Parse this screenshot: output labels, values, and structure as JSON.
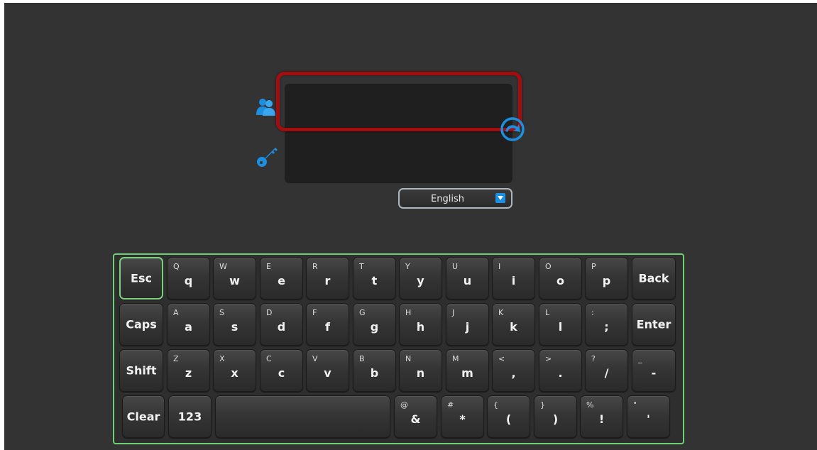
{
  "login": {
    "username_value": "",
    "password_value": ""
  },
  "language": {
    "selected": "English"
  },
  "icons": {
    "user": "users-icon",
    "password": "key-icon",
    "submit": "go-arrow-icon",
    "dropdown": "chevron-down-icon"
  },
  "colors": {
    "accent": "#1d8fe0",
    "highlight": "#a30d10",
    "keyboard_border": "#6fcf75",
    "background": "#333333"
  },
  "keyboard": {
    "esc": "Esc",
    "back": "Back",
    "caps": "Caps",
    "enter": "Enter",
    "shift": "Shift",
    "clear": "Clear",
    "num": "123",
    "space": "",
    "row1": [
      {
        "main": "q",
        "sub": "Q"
      },
      {
        "main": "w",
        "sub": "W"
      },
      {
        "main": "e",
        "sub": "E"
      },
      {
        "main": "r",
        "sub": "R"
      },
      {
        "main": "t",
        "sub": "T"
      },
      {
        "main": "y",
        "sub": "Y"
      },
      {
        "main": "u",
        "sub": "U"
      },
      {
        "main": "i",
        "sub": "I"
      },
      {
        "main": "o",
        "sub": "O"
      },
      {
        "main": "p",
        "sub": "P"
      }
    ],
    "row2": [
      {
        "main": "a",
        "sub": "A"
      },
      {
        "main": "s",
        "sub": "S"
      },
      {
        "main": "d",
        "sub": "D"
      },
      {
        "main": "f",
        "sub": "F"
      },
      {
        "main": "g",
        "sub": "G"
      },
      {
        "main": "h",
        "sub": "H"
      },
      {
        "main": "j",
        "sub": "J"
      },
      {
        "main": "k",
        "sub": "K"
      },
      {
        "main": "l",
        "sub": "L"
      },
      {
        "main": ";",
        "sub": ":"
      }
    ],
    "row3": [
      {
        "main": "z",
        "sub": "Z"
      },
      {
        "main": "x",
        "sub": "X"
      },
      {
        "main": "c",
        "sub": "C"
      },
      {
        "main": "v",
        "sub": "V"
      },
      {
        "main": "b",
        "sub": "B"
      },
      {
        "main": "n",
        "sub": "N"
      },
      {
        "main": "m",
        "sub": "M"
      },
      {
        "main": ",",
        "sub": "<"
      },
      {
        "main": ".",
        "sub": ">"
      },
      {
        "main": "/",
        "sub": "?"
      },
      {
        "main": "-",
        "sub": "_"
      }
    ],
    "row4": [
      {
        "main": "&",
        "sub": "@"
      },
      {
        "main": "*",
        "sub": "#"
      },
      {
        "main": "(",
        "sub": "{"
      },
      {
        "main": ")",
        "sub": "}"
      },
      {
        "main": "!",
        "sub": "%"
      },
      {
        "main": "'",
        "sub": "\""
      }
    ]
  }
}
